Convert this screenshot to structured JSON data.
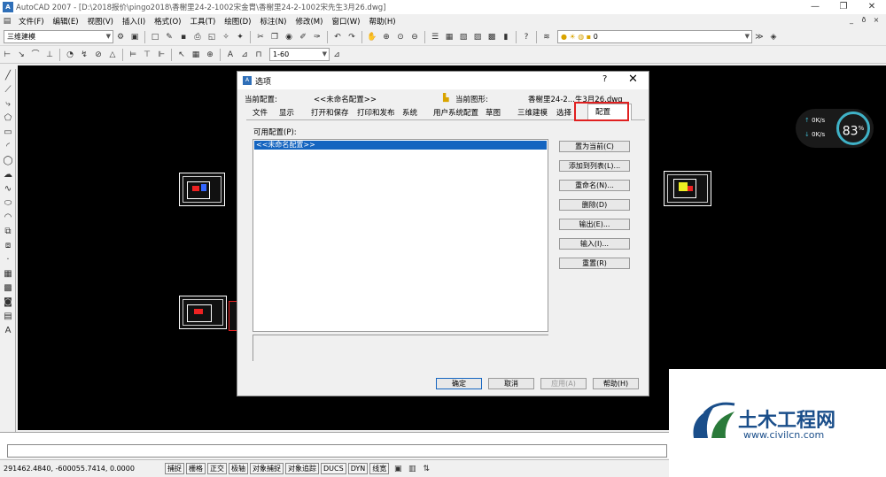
{
  "window": {
    "title": "AutoCAD 2007 - [D:\\2018报价\\pingo2018\\香榭里24-2-1002宋金胄\\香榭里24-2-1002宋先生3月26.dwg]",
    "app_icon": "acad-logo-icon",
    "minimize": "—",
    "restore": "❐",
    "close": "✕"
  },
  "menu": {
    "items": [
      "文件(F)",
      "编辑(E)",
      "视图(V)",
      "插入(I)",
      "格式(O)",
      "工具(T)",
      "绘图(D)",
      "标注(N)",
      "修改(M)",
      "窗口(W)",
      "帮助(H)"
    ],
    "mdi_min": "_",
    "mdi_restore": "ð",
    "mdi_close": "×"
  },
  "toolbar": {
    "workspace": "三维建模",
    "layer": "0",
    "dim_style": "1-60"
  },
  "dialog": {
    "title": "选项",
    "help": "?",
    "close": "✕",
    "current_profile_label": "当前配置:",
    "current_profile_value": "<<未命名配置>>",
    "current_drawing_label": "当前图形:",
    "current_drawing_value": "香榭里24-2...生3月26.dwg",
    "tabs": [
      "文件",
      "显示",
      "打开和保存",
      "打印和发布",
      "系统",
      "用户系统配置",
      "草图",
      "三维建模",
      "选择"
    ],
    "active_tab": "配置",
    "available_label": "可用配置(P):",
    "profiles": [
      "<<未命名配置>>"
    ],
    "buttons": {
      "set_current": "置为当前(C)",
      "add_to_list": "添加到列表(L)...",
      "rename": "重命名(N)...",
      "delete": "删除(D)",
      "export": "输出(E)...",
      "import": "输入(I)...",
      "reset": "重置(R)"
    },
    "ok": "确定",
    "cancel": "取消",
    "apply": "应用(A)",
    "help_btn": "帮助(H)"
  },
  "status": {
    "coords": "291462.4840, -600055.7414, 0.0000",
    "toggles": [
      "捕捉",
      "栅格",
      "正交",
      "极轴",
      "对象捕捉",
      "对象追踪",
      "DUCS",
      "DYN",
      "线宽"
    ]
  },
  "gauge": {
    "percent": "83",
    "percent_sign": "%",
    "up": "0K/s",
    "down": "0K/s",
    "accent": "#3fb2c7"
  },
  "watermark": {
    "name": "土木工程网",
    "url": "www.civilcn.com"
  }
}
